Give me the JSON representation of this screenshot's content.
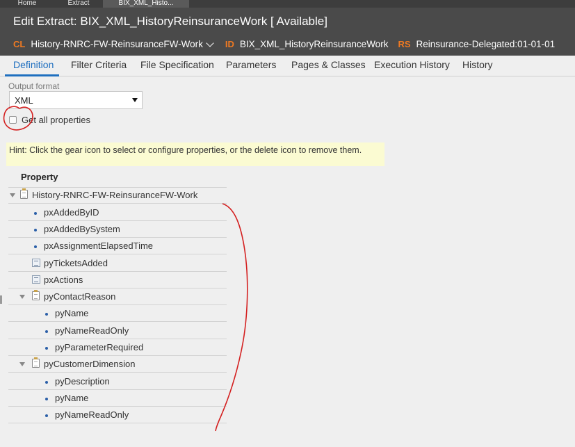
{
  "top_tabs": [
    "Home",
    "Extract",
    "BIX_XML_Histo..."
  ],
  "header": {
    "title": "Edit  Extract: BIX_XML_HistoryReinsuranceWork [ Available]",
    "cl_tag": "CL",
    "cl_value": "History-RNRC-FW-ReinsuranceFW-Work",
    "id_tag": "ID",
    "id_value": "BIX_XML_HistoryReinsuranceWork",
    "rs_tag": "RS",
    "rs_value": "Reinsurance-Delegated:01-01-01",
    "accent_color": "#f07a22"
  },
  "tabs": [
    "Definition",
    "Filter Criteria",
    "File Specification",
    "Parameters",
    "Pages & Classes",
    "Execution History",
    "History"
  ],
  "active_tab": "Definition",
  "output_format": {
    "label": "Output format",
    "selected": "XML"
  },
  "get_all_properties": {
    "label": "Get all properties",
    "checked": false
  },
  "hint": "Hint: Click the gear icon to select or configure properties, or the delete icon to remove them.",
  "tree": {
    "header": "Property",
    "rows": [
      {
        "label": "History-RNRC-FW-ReinsuranceFW-Work",
        "icon": "page-icon",
        "expanded": true
      },
      {
        "label": "pxAddedByID",
        "icon": "bullet-icon"
      },
      {
        "label": "pxAddedBySystem",
        "icon": "bullet-icon"
      },
      {
        "label": "pxAssignmentElapsedTime",
        "icon": "bullet-icon"
      },
      {
        "label": "pyTicketsAdded",
        "icon": "list-icon"
      },
      {
        "label": "pxActions",
        "icon": "list-icon"
      },
      {
        "label": "pyContactReason",
        "icon": "page-icon",
        "expanded": true
      },
      {
        "label": "pyName",
        "icon": "bullet-icon"
      },
      {
        "label": "pyNameReadOnly",
        "icon": "bullet-icon"
      },
      {
        "label": "pyParameterRequired",
        "icon": "bullet-icon"
      },
      {
        "label": "pyCustomerDimension",
        "icon": "page-icon",
        "expanded": true
      },
      {
        "label": "pyDescription",
        "icon": "bullet-icon"
      },
      {
        "label": "pyName",
        "icon": "bullet-icon"
      },
      {
        "label": "pyNameReadOnly",
        "icon": "bullet-icon"
      }
    ]
  },
  "active_color": "#1f6fbf"
}
